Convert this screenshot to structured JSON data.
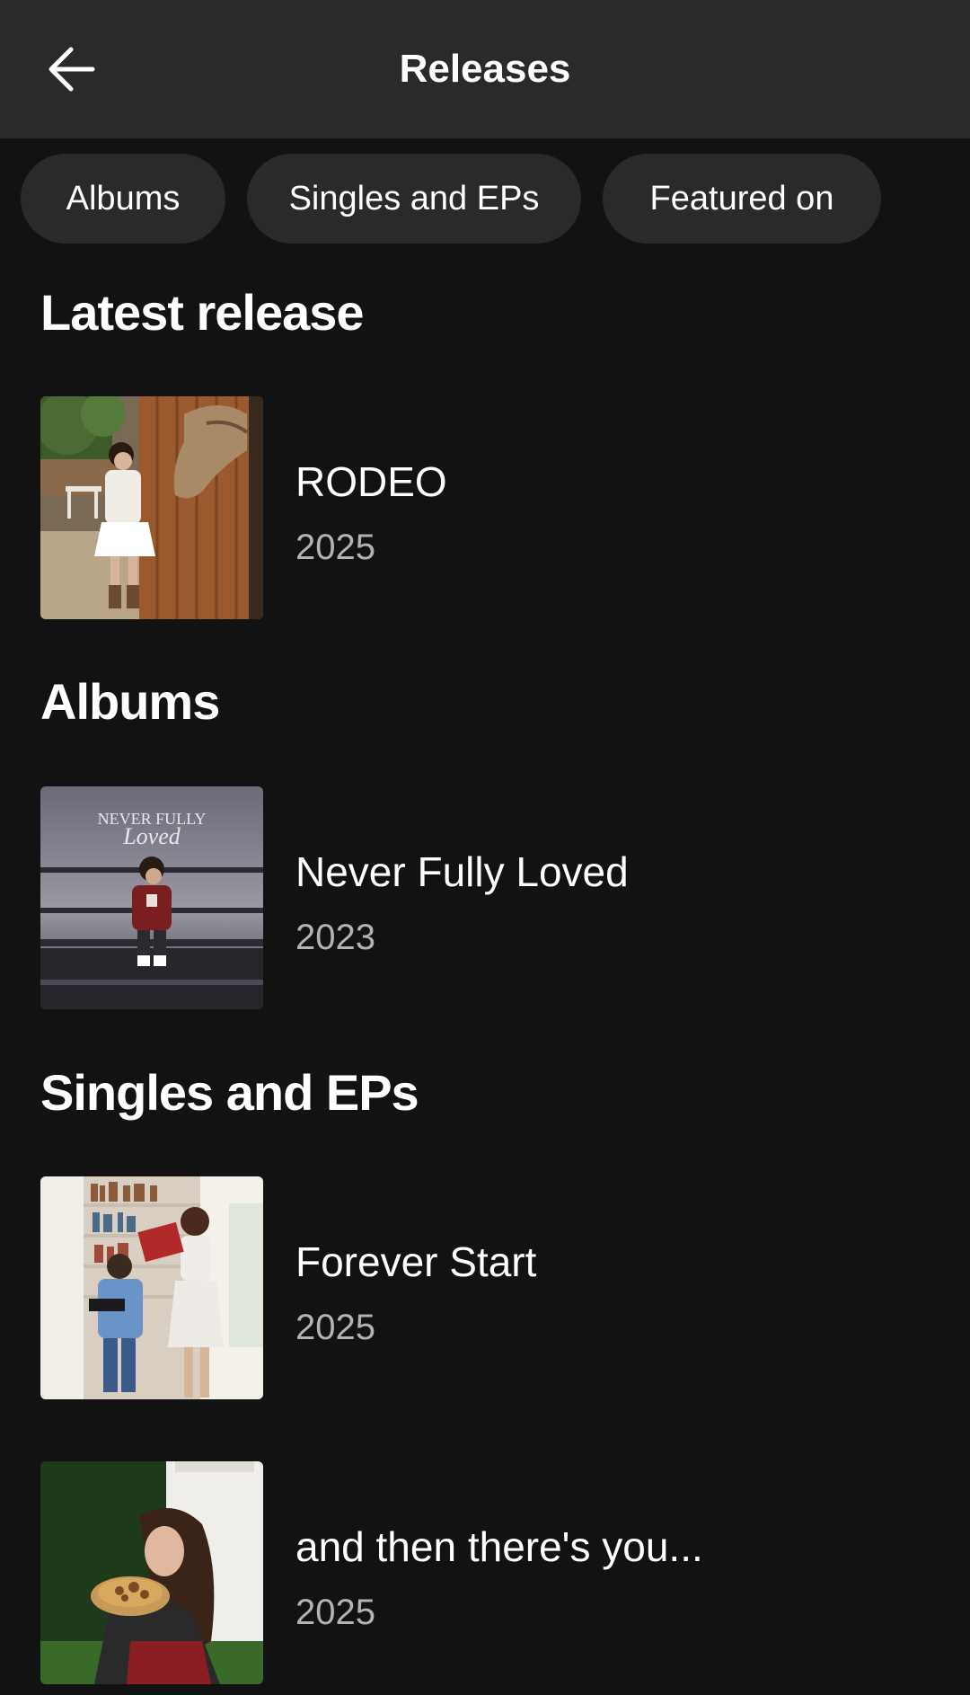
{
  "header": {
    "back_icon": "arrow-left-icon",
    "title": "Releases"
  },
  "chips": [
    {
      "label": "Albums"
    },
    {
      "label": "Singles and EPs"
    },
    {
      "label": "Featured on"
    }
  ],
  "sections": {
    "latest": {
      "title": "Latest release",
      "items": [
        {
          "title": "RODEO",
          "year": "2025"
        }
      ]
    },
    "albums": {
      "title": "Albums",
      "items": [
        {
          "title": "Never Fully Loved",
          "year": "2023",
          "cover_text": "NEVER FULLY Loved"
        }
      ]
    },
    "singles": {
      "title": "Singles and EPs",
      "items": [
        {
          "title": "Forever Start",
          "year": "2025"
        },
        {
          "title": "and then there's you...",
          "year": "2025"
        }
      ]
    }
  },
  "colors": {
    "background": "#121212",
    "header": "#2a2a2a",
    "chip": "#2a2a2a",
    "text_primary": "#ffffff",
    "text_secondary": "#b3b3b3"
  }
}
